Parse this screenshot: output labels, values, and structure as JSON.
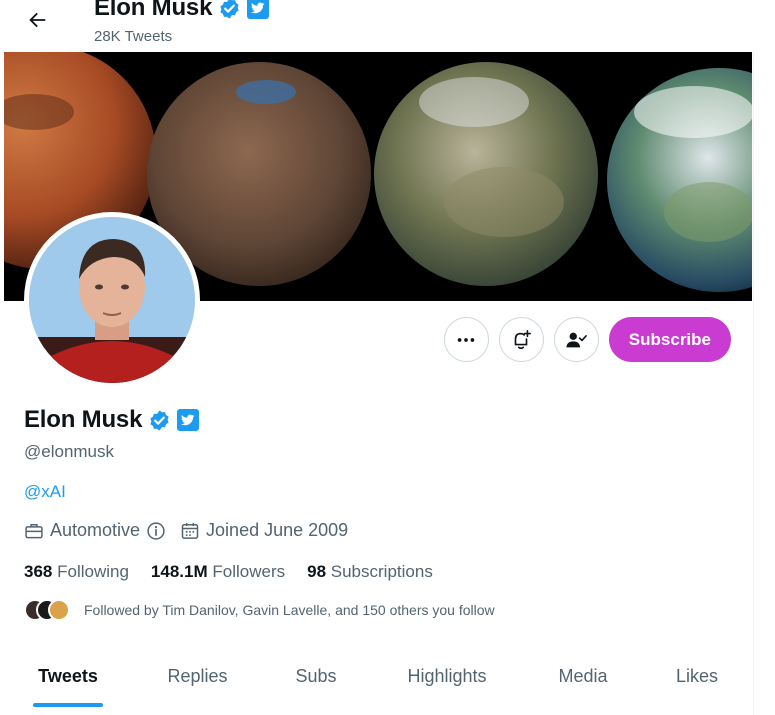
{
  "header": {
    "name": "Elon Musk",
    "tweet_count": "28K Tweets"
  },
  "profile": {
    "name": "Elon Musk",
    "handle": "@elonmusk",
    "bio_link": "@xAI",
    "category": "Automotive",
    "joined": "Joined June 2009",
    "verified_color": "#1d9bf0",
    "stats": {
      "following_count": "368",
      "following_label": "Following",
      "followers_count": "148.1M",
      "followers_label": "Followers",
      "subscriptions_count": "98",
      "subscriptions_label": "Subscriptions"
    },
    "followed_by": "Followed by Tim Danilov, Gavin Lavelle, and 150 others you follow"
  },
  "actions": {
    "subscribe_label": "Subscribe",
    "subscribe_color": "#c93bd1"
  },
  "tabs": [
    {
      "label": "Tweets",
      "active": true
    },
    {
      "label": "Replies",
      "active": false
    },
    {
      "label": "Subs",
      "active": false
    },
    {
      "label": "Highlights",
      "active": false
    },
    {
      "label": "Media",
      "active": false
    },
    {
      "label": "Likes",
      "active": false
    }
  ]
}
